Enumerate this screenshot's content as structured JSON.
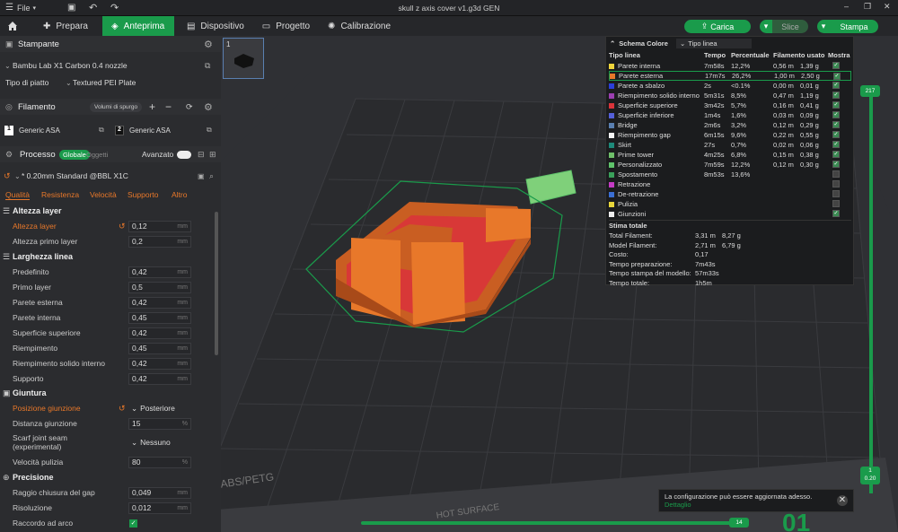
{
  "titlebar": {
    "menu": "File",
    "title": "skull z axis cover v1.g3d GEN"
  },
  "tabs": [
    {
      "label": "Prepara"
    },
    {
      "label": "Anteprima"
    },
    {
      "label": "Dispositivo"
    },
    {
      "label": "Progetto"
    },
    {
      "label": "Calibrazione"
    }
  ],
  "actions": {
    "carica": "Carica",
    "slice": "Slice",
    "stampa": "Stampa"
  },
  "printer": {
    "section": "Stampante",
    "name": "Bambu Lab X1 Carbon 0.4 nozzle",
    "plate_label": "Tipo di piatto",
    "plate_value": "Textured PEI Plate"
  },
  "filament": {
    "section": "Filamento",
    "purge_btn": "Volumi di spurgo",
    "items": [
      {
        "num": "1",
        "name": "Generic ASA"
      },
      {
        "num": "2",
        "name": "Generic ASA"
      }
    ]
  },
  "process": {
    "section": "Processo",
    "globale": "Globale",
    "oggetti": "Oggetti",
    "advanced": "Avanzato",
    "preset": "* 0.20mm Standard @BBL X1C"
  },
  "proc_tabs": [
    "Qualità",
    "Resistenza",
    "Velocità",
    "Supporto",
    "Altro"
  ],
  "quality": {
    "layer_height": {
      "title": "Altezza layer",
      "rows": [
        {
          "label": "Altezza layer",
          "value": "0,12",
          "unit": "mm"
        },
        {
          "label": "Altezza primo layer",
          "value": "0,2",
          "unit": "mm"
        }
      ]
    },
    "line_width": {
      "title": "Larghezza linea",
      "rows": [
        {
          "label": "Predefinito",
          "value": "0,42",
          "unit": "mm"
        },
        {
          "label": "Primo layer",
          "value": "0,5",
          "unit": "mm"
        },
        {
          "label": "Parete esterna",
          "value": "0,42",
          "unit": "mm"
        },
        {
          "label": "Parete interna",
          "value": "0,45",
          "unit": "mm"
        },
        {
          "label": "Superficie superiore",
          "value": "0,42",
          "unit": "mm"
        },
        {
          "label": "Riempimento",
          "value": "0,45",
          "unit": "mm"
        },
        {
          "label": "Riempimento solido interno",
          "value": "0,42",
          "unit": "mm"
        },
        {
          "label": "Supporto",
          "value": "0,42",
          "unit": "mm"
        }
      ]
    },
    "seam": {
      "title": "Giuntura",
      "position_label": "Posizione giunzione",
      "position_value": "Posteriore",
      "distance_label": "Distanza giunzione",
      "distance_value": "15",
      "distance_unit": "%",
      "scarf_label": "Scarf joint seam (experimental)",
      "scarf_value": "Nessuno",
      "wipe_label": "Velocità pulizia",
      "wipe_value": "80",
      "wipe_unit": "%"
    },
    "precision": {
      "title": "Precisione",
      "rows": [
        {
          "label": "Raggio chiusura del gap",
          "value": "0,049",
          "unit": "mm"
        },
        {
          "label": "Risoluzione",
          "value": "0,012",
          "unit": "mm"
        }
      ],
      "arc_label": "Raccordo ad arco"
    }
  },
  "thumbnail": {
    "number": "1"
  },
  "legend": {
    "title": "Schema Colore",
    "dropdown": "Tipo linea",
    "headers": [
      "Tipo linea",
      "Tempo",
      "Percentuale",
      "Filamento usato",
      "Mostra"
    ],
    "rows": [
      {
        "name": "Parete interna",
        "color": "#f0d53c",
        "time": "7m58s",
        "pct": "12,2%",
        "fil": "0,56 m",
        "g": "1,39 g",
        "show": true
      },
      {
        "name": "Parete esterna",
        "color": "#e8782a",
        "time": "17m7s",
        "pct": "26,2%",
        "fil": "1,00 m",
        "g": "2,50 g",
        "show": true
      },
      {
        "name": "Parete a sbalzo",
        "color": "#2b3fd8",
        "time": "2s",
        "pct": "<0.1%",
        "fil": "0,00 m",
        "g": "0,01 g",
        "show": true
      },
      {
        "name": "Riempimento solido interno",
        "color": "#9b3fb0",
        "time": "5m31s",
        "pct": "8,5%",
        "fil": "0,47 m",
        "g": "1,19 g",
        "show": true
      },
      {
        "name": "Superficie superiore",
        "color": "#d9343a",
        "time": "3m42s",
        "pct": "5,7%",
        "fil": "0,16 m",
        "g": "0,41 g",
        "show": true
      },
      {
        "name": "Superficie inferiore",
        "color": "#5560d8",
        "time": "1m4s",
        "pct": "1,6%",
        "fil": "0,03 m",
        "g": "0,09 g",
        "show": true
      },
      {
        "name": "Bridge",
        "color": "#5a7fb0",
        "time": "2m6s",
        "pct": "3,2%",
        "fil": "0,12 m",
        "g": "0,29 g",
        "show": true
      },
      {
        "name": "Riempimento gap",
        "color": "#f4f4f4",
        "time": "6m15s",
        "pct": "9,6%",
        "fil": "0,22 m",
        "g": "0,55 g",
        "show": true
      },
      {
        "name": "Skirt",
        "color": "#1e8a7a",
        "time": "27s",
        "pct": "0,7%",
        "fil": "0,02 m",
        "g": "0,06 g",
        "show": true
      },
      {
        "name": "Prime tower",
        "color": "#6fbf6a",
        "time": "4m25s",
        "pct": "6,8%",
        "fil": "0,15 m",
        "g": "0,38 g",
        "show": true
      },
      {
        "name": "Personalizzato",
        "color": "#5fc36b",
        "time": "7m59s",
        "pct": "12,2%",
        "fil": "0,12 m",
        "g": "0,30 g",
        "show": true
      },
      {
        "name": "Spostamento",
        "color": "#3aa05a",
        "time": "8m53s",
        "pct": "13,6%",
        "fil": "",
        "g": "",
        "show": false
      },
      {
        "name": "Retrazione",
        "color": "#c43bc4",
        "time": "",
        "pct": "",
        "fil": "",
        "g": "",
        "show": false
      },
      {
        "name": "De-retrazione",
        "color": "#3b6fd4",
        "time": "",
        "pct": "",
        "fil": "",
        "g": "",
        "show": false
      },
      {
        "name": "Pulizia",
        "color": "#e8d63b",
        "time": "",
        "pct": "",
        "fil": "",
        "g": "",
        "show": false
      },
      {
        "name": "Giunzioni",
        "color": "#eeeeee",
        "time": "",
        "pct": "",
        "fil": "",
        "g": "",
        "show": true
      }
    ],
    "estimate_title": "Stima totale",
    "estimates": [
      {
        "label": "Total Filament:",
        "v1": "3,31 m",
        "v2": "8,27 g"
      },
      {
        "label": "Model Filament:",
        "v1": "2,71 m",
        "v2": "6,79 g"
      },
      {
        "label": "Costo:",
        "v1": "0,17",
        "v2": ""
      },
      {
        "label": "Tempo preparazione:",
        "v1": "7m43s",
        "v2": ""
      },
      {
        "label": "Tempo stampa del modello:",
        "v1": "57m33s",
        "v2": ""
      },
      {
        "label": "Tempo totale:",
        "v1": "1h5m",
        "v2": ""
      }
    ]
  },
  "slider": {
    "top_layer": "217",
    "top_height": "",
    "bottom_layer": "1",
    "bottom_height": "0.20",
    "h_value": "14"
  },
  "bed": {
    "label1": "ABS/PETG",
    "label2": "HOT SURFACE",
    "number": "01"
  },
  "notification": {
    "text": "La configurazione può essere aggiornata adesso.",
    "link": "Dettaglio"
  }
}
